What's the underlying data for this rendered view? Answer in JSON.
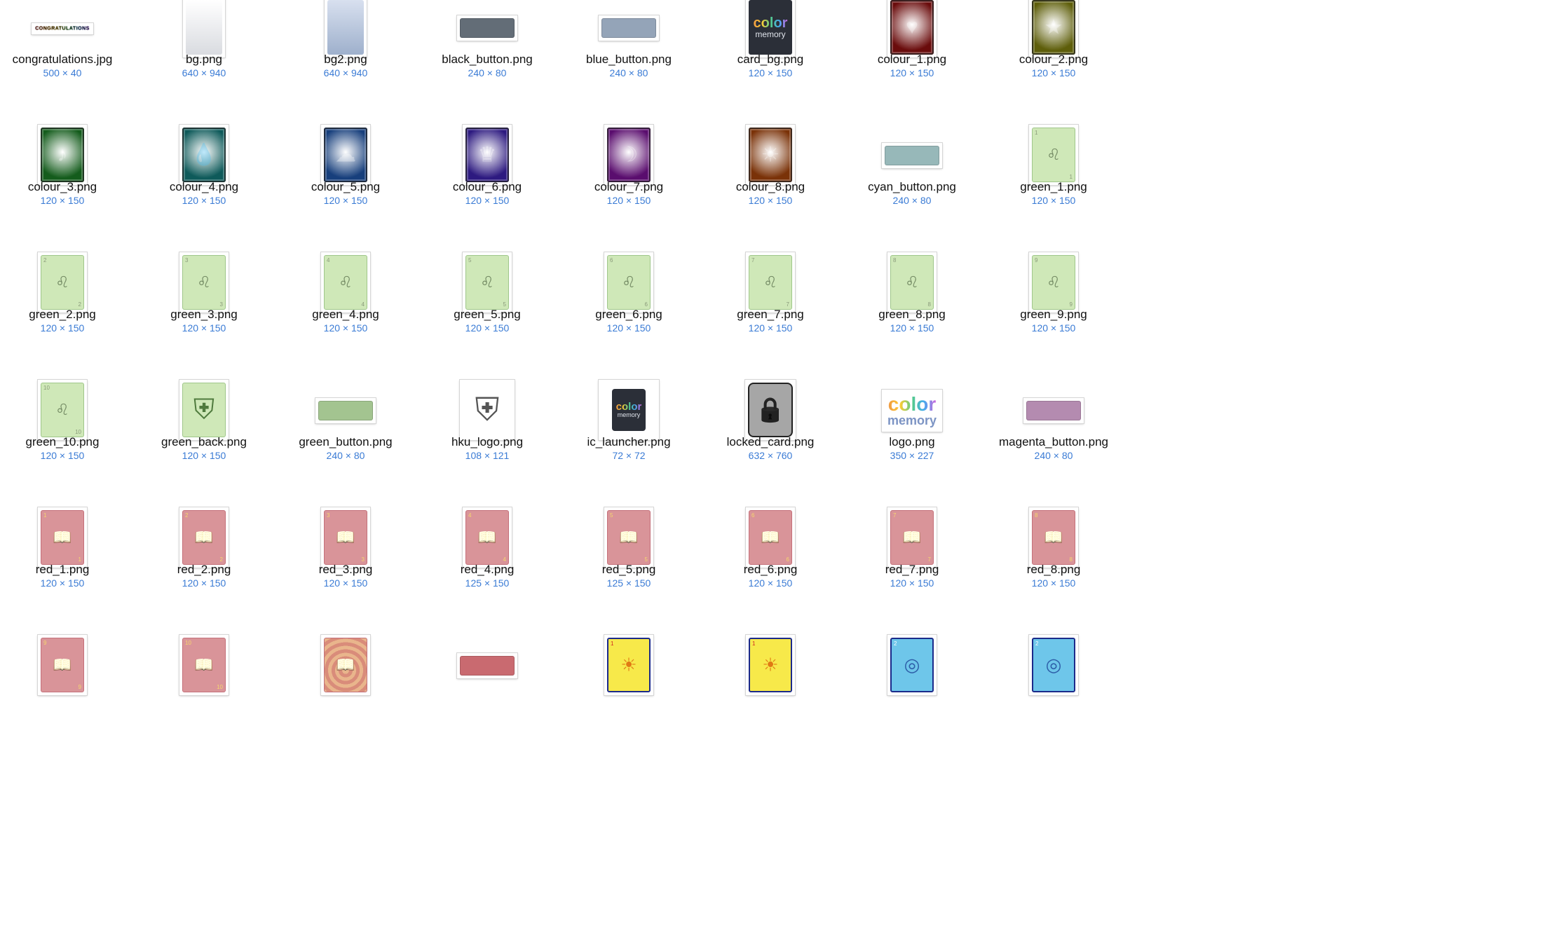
{
  "files": [
    {
      "name": "congratulations.jpg",
      "dims": "500 × 40",
      "kind": "banner",
      "banner_text": "CONGRATULATIONS"
    },
    {
      "name": "bg.png",
      "dims": "640 × 940",
      "kind": "gradient",
      "colors": [
        "#ffffff",
        "#d9dbe0"
      ]
    },
    {
      "name": "bg2.png",
      "dims": "640 × 940",
      "kind": "gradient",
      "colors": [
        "#d8e0ef",
        "#9eb0cc"
      ]
    },
    {
      "name": "black_button.png",
      "dims": "240 × 80",
      "kind": "button",
      "color": "#636d77"
    },
    {
      "name": "blue_button.png",
      "dims": "240 × 80",
      "kind": "button",
      "color": "#94a4b8"
    },
    {
      "name": "card_bg.png",
      "dims": "120 × 150",
      "kind": "cardbg",
      "logo_line1": "color",
      "logo_line2": "memory"
    },
    {
      "name": "colour_1.png",
      "dims": "120 × 150",
      "kind": "colour",
      "color": "#6a0c0c",
      "icon": "heart-icon",
      "glyph": "♥"
    },
    {
      "name": "colour_2.png",
      "dims": "120 × 150",
      "kind": "colour",
      "color": "#5e5e0a",
      "icon": "star-icon",
      "glyph": "★"
    },
    {
      "name": "colour_3.png",
      "dims": "120 × 150",
      "kind": "colour",
      "color": "#145c1c",
      "icon": "music-note-icon",
      "glyph": "♪"
    },
    {
      "name": "colour_4.png",
      "dims": "120 × 150",
      "kind": "colour",
      "color": "#0e5a5a",
      "icon": "water-drop-icon",
      "glyph": "💧"
    },
    {
      "name": "colour_5.png",
      "dims": "120 × 150",
      "kind": "colour",
      "color": "#173f7c",
      "icon": "cloud-icon",
      "glyph": "☁"
    },
    {
      "name": "colour_6.png",
      "dims": "120 × 150",
      "kind": "colour",
      "color": "#2d1a80",
      "icon": "crown-icon",
      "glyph": "♛"
    },
    {
      "name": "colour_7.png",
      "dims": "120 × 150",
      "kind": "colour",
      "color": "#5a0d6e",
      "icon": "moon-icon",
      "glyph": "☽"
    },
    {
      "name": "colour_8.png",
      "dims": "120 × 150",
      "kind": "colour",
      "color": "#7a3208",
      "icon": "sun-icon",
      "glyph": "☀"
    },
    {
      "name": "cyan_button.png",
      "dims": "240 × 80",
      "kind": "button",
      "color": "#97b8b9"
    },
    {
      "name": "green_1.png",
      "dims": "120 × 150",
      "kind": "green",
      "num": "1"
    },
    {
      "name": "green_2.png",
      "dims": "120 × 150",
      "kind": "green",
      "num": "2"
    },
    {
      "name": "green_3.png",
      "dims": "120 × 150",
      "kind": "green",
      "num": "3"
    },
    {
      "name": "green_4.png",
      "dims": "120 × 150",
      "kind": "green",
      "num": "4"
    },
    {
      "name": "green_5.png",
      "dims": "120 × 150",
      "kind": "green",
      "num": "5"
    },
    {
      "name": "green_6.png",
      "dims": "120 × 150",
      "kind": "green",
      "num": "6"
    },
    {
      "name": "green_7.png",
      "dims": "120 × 150",
      "kind": "green",
      "num": "7"
    },
    {
      "name": "green_8.png",
      "dims": "120 × 150",
      "kind": "green",
      "num": "8"
    },
    {
      "name": "green_9.png",
      "dims": "120 × 150",
      "kind": "green",
      "num": "9"
    },
    {
      "name": "green_10.png",
      "dims": "120 × 150",
      "kind": "green",
      "num": "10"
    },
    {
      "name": "green_back.png",
      "dims": "120 × 150",
      "kind": "greenback"
    },
    {
      "name": "green_button.png",
      "dims": "240 × 80",
      "kind": "button",
      "color": "#a3c490"
    },
    {
      "name": "hku_logo.png",
      "dims": "108 × 121",
      "kind": "hku"
    },
    {
      "name": "ic_launcher.png",
      "dims": "72 × 72",
      "kind": "launcher",
      "logo_line1": "color",
      "logo_line2": "memory"
    },
    {
      "name": "locked_card.png",
      "dims": "632 × 760",
      "kind": "locked"
    },
    {
      "name": "logo.png",
      "dims": "350 × 227",
      "kind": "logo",
      "logo_line1": "color",
      "logo_line2": "memory"
    },
    {
      "name": "magenta_button.png",
      "dims": "240 × 80",
      "kind": "button",
      "color": "#b48bb0"
    },
    {
      "name": "red_1.png",
      "dims": "120 × 150",
      "kind": "red",
      "num": "1"
    },
    {
      "name": "red_2.png",
      "dims": "120 × 150",
      "kind": "red",
      "num": "2"
    },
    {
      "name": "red_3.png",
      "dims": "120 × 150",
      "kind": "red",
      "num": "3"
    },
    {
      "name": "red_4.png",
      "dims": "125 × 150",
      "kind": "red",
      "num": "4"
    },
    {
      "name": "red_5.png",
      "dims": "125 × 150",
      "kind": "red",
      "num": "5"
    },
    {
      "name": "red_6.png",
      "dims": "120 × 150",
      "kind": "red",
      "num": "6"
    },
    {
      "name": "red_7.png",
      "dims": "120 × 150",
      "kind": "red",
      "num": "7"
    },
    {
      "name": "red_8.png",
      "dims": "120 × 150",
      "kind": "red",
      "num": "8"
    },
    {
      "kind": "red",
      "num": "9"
    },
    {
      "kind": "red",
      "num": "10"
    },
    {
      "kind": "redback"
    },
    {
      "kind": "button",
      "color": "#c96a70"
    },
    {
      "kind": "yellow",
      "num": "1",
      "icon": "sun-emblem-icon"
    },
    {
      "kind": "yellow",
      "num": "1",
      "icon": "creature-icon"
    },
    {
      "kind": "blue",
      "num": "2",
      "icon": "emblem-icon"
    },
    {
      "kind": "blue",
      "num": "2",
      "icon": "creature-icon"
    }
  ],
  "colors": {
    "green_card": "#cfe8b8",
    "green_card_border": "#9fc68a",
    "red_card": "#d99499",
    "red_card_border": "#c4707a",
    "dims_text": "#3a7bd5",
    "locked_card": "#a6a6a6"
  }
}
